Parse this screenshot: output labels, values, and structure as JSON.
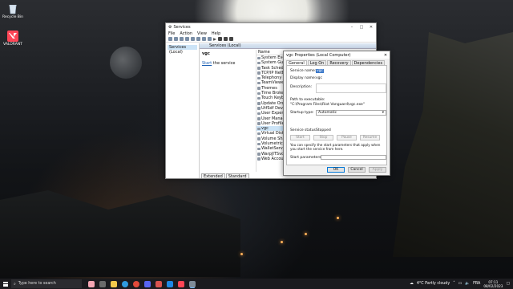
{
  "desktop": {
    "icons": [
      {
        "label": "Recycle Bin",
        "icon": "recycle-bin-icon"
      },
      {
        "label": "VALORANT",
        "icon": "valorant-icon"
      }
    ]
  },
  "services_window": {
    "title": "Services",
    "menu": [
      "File",
      "Action",
      "View",
      "Help"
    ],
    "tree_item": "Services (Local)",
    "pane_header": "Services (Local)",
    "selected_name": "vgc",
    "start_link": "Start",
    "start_suffix": " the service",
    "column_header": "Name",
    "rows": [
      "System Events I",
      "System Guard R",
      "Task Schedule",
      "TCP/IP NetBIO",
      "Telephony",
      "TeamViewer",
      "Themes",
      "Time Broker",
      "Touch Keyboar",
      "Update Orchest",
      "UtfSdf Device H",
      "User Experienc",
      "User Manager",
      "User Profile Se",
      "vgc",
      "Virtual Disk",
      "Volume Shado",
      "Volumetric Aud",
      "WalletService",
      "WarpJITSvc",
      "Web Account M"
    ],
    "selected_row": 14,
    "tabs": [
      "Extended",
      "Standard"
    ]
  },
  "properties_dialog": {
    "title": "vgc Properties (Local Computer)",
    "close": "✕",
    "tabs": [
      "General",
      "Log On",
      "Recovery",
      "Dependencies"
    ],
    "service_name_label": "Service name:",
    "service_name_value": "vgc",
    "display_name_label": "Display name:",
    "display_name_value": "vgc",
    "description_label": "Description:",
    "path_label": "Path to executable:",
    "path_value": "\"C:\\Program Files\\Riot Vanguard\\vgc.exe\"",
    "startup_type_label": "Startup type:",
    "startup_type_value": "Automatic",
    "service_status_label": "Service status:",
    "service_status_value": "Stopped",
    "buttons": [
      "Start",
      "Stop",
      "Pause",
      "Resume"
    ],
    "note": "You can specify the start parameters that apply when you start the service from here.",
    "start_params_label": "Start parameters:",
    "footer": [
      "OK",
      "Cancel",
      "Apply"
    ]
  },
  "taskbar": {
    "search_placeholder": "Type here to search",
    "weather": "4°C  Partly cloudy",
    "language": "FRA",
    "time": "07:11",
    "date": "08/02/2023"
  },
  "colors": {
    "accent": "#0078d7",
    "selection": "#cce4f7"
  }
}
